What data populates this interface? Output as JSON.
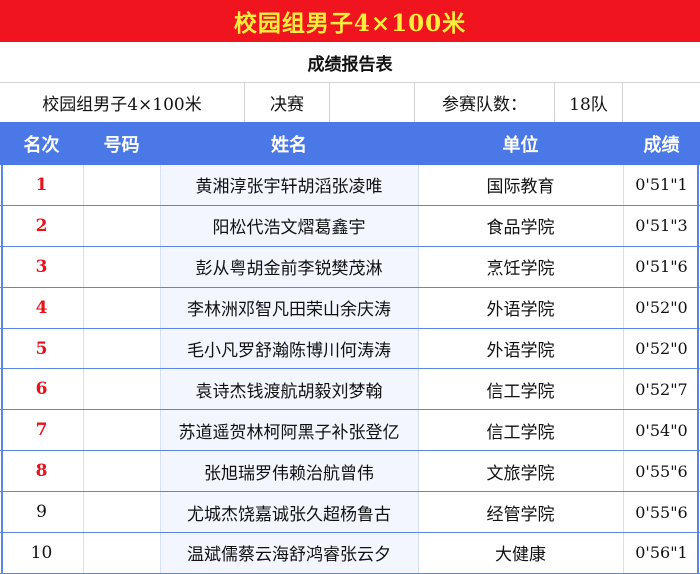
{
  "title": "校园组男子4×100米",
  "subtitle": "成绩报告表",
  "info": {
    "event": "校园组男子4×100米",
    "round": "决赛",
    "count_label": "参赛队数：",
    "count_value": "18队"
  },
  "columns": [
    "名次",
    "号码",
    "姓名",
    "单位",
    "成绩"
  ],
  "rows": [
    {
      "rank": "1",
      "number": "",
      "names": "黄湘淳张宇轩胡滔张凌唯",
      "unit": "国际教育",
      "score": "0'51\"1",
      "highlight": true
    },
    {
      "rank": "2",
      "number": "",
      "names": "阳松代浩文熠葛鑫宇",
      "unit": "食品学院",
      "score": "0'51\"3",
      "highlight": true
    },
    {
      "rank": "3",
      "number": "",
      "names": "彭从粤胡金前李锐樊茂淋",
      "unit": "烹饪学院",
      "score": "0'51\"6",
      "highlight": true
    },
    {
      "rank": "4",
      "number": "",
      "names": "李林洲邓智凡田荣山余庆涛",
      "unit": "外语学院",
      "score": "0'52\"0",
      "highlight": true
    },
    {
      "rank": "5",
      "number": "",
      "names": "毛小凡罗舒瀚陈博川何涛涛",
      "unit": "外语学院",
      "score": "0'52\"0",
      "highlight": true
    },
    {
      "rank": "6",
      "number": "",
      "names": "袁诗杰钱渡航胡毅刘梦翰",
      "unit": "信工学院",
      "score": "0'52\"7",
      "highlight": true
    },
    {
      "rank": "7",
      "number": "",
      "names": "苏道遥贺林柯阿黑子补张登亿",
      "unit": "信工学院",
      "score": "0'54\"0",
      "highlight": true
    },
    {
      "rank": "8",
      "number": "",
      "names": "张旭瑞罗伟赖治航曾伟",
      "unit": "文旅学院",
      "score": "0'55\"6",
      "highlight": true
    },
    {
      "rank": "9",
      "number": "",
      "names": "尤城杰饶嘉诚张久超杨鲁古",
      "unit": "经管学院",
      "score": "0'55\"6",
      "highlight": false
    },
    {
      "rank": "10",
      "number": "",
      "names": "温斌儒蔡云海舒鸿睿张云夕",
      "unit": "大健康",
      "score": "0'56\"1",
      "highlight": false
    }
  ],
  "colors": {
    "title_bg": "#f0141e",
    "title_text": "#ffef3c",
    "header_bg": "#4a78e6",
    "rank_highlight": "#e8121c"
  }
}
